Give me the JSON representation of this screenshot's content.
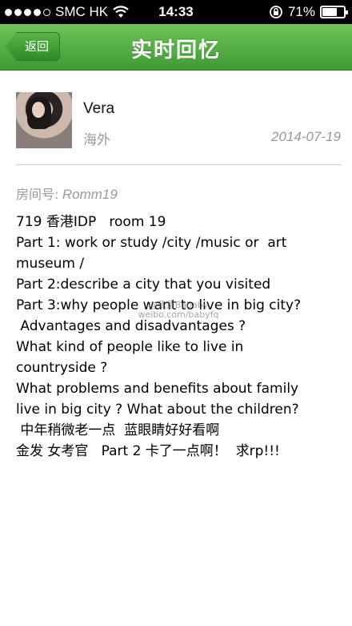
{
  "status_bar": {
    "carrier": "SMC HK",
    "time": "14:33",
    "battery": "71%",
    "battery_level": 0.71,
    "signal_dots_filled": 4,
    "signal_dots_total": 5
  },
  "nav": {
    "back_label": "返回",
    "title": "实时回忆"
  },
  "profile": {
    "username": "Vera",
    "location": "海外",
    "date": "2014-07-19"
  },
  "room": {
    "label": "房间号:",
    "value": "Romm19"
  },
  "content_lines": [
    "719 香港IDP   room 19",
    "Part 1: work or study /city /music or  art",
    "museum /",
    "Part 2:describe a city that you visited",
    "Part 3:why people want to live in big city?",
    " Advantages and disadvantages ?",
    "What kind of people like to live in",
    "countryside ?",
    "What problems and benefits about family",
    "live in big city ? What about the children?",
    " 中年稍微老一点  蓝眼睛好好看啊",
    "金发 女考官   Part 2 卡了一点啊！  求rp!!!"
  ],
  "watermark": {
    "line1": "@我是Bababy",
    "line2": "weibo.com/babyfq"
  },
  "colors": {
    "nav_green_top": "#6fc458",
    "nav_green_bottom": "#3e9a34",
    "muted_text": "#999999"
  }
}
